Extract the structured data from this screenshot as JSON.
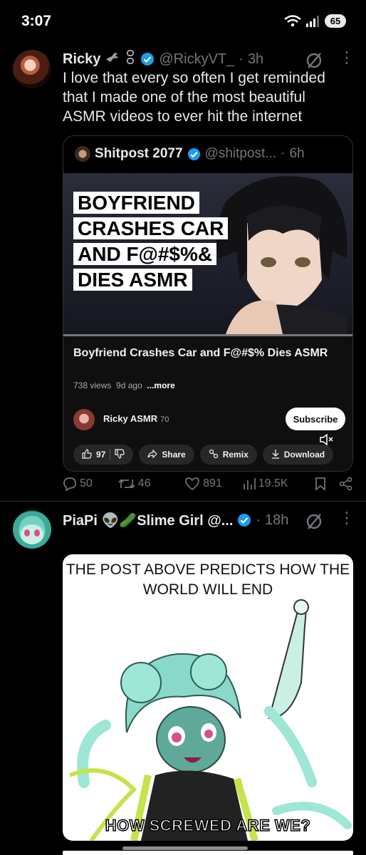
{
  "status_bar": {
    "time": "3:07",
    "battery": "65"
  },
  "post1": {
    "name": "Ricky",
    "handle": "@RickyVT_",
    "separator": "·",
    "time": "3h",
    "text": "I love that every so often I get reminded that I made one of the most beautiful ASMR videos to ever hit the internet",
    "quote": {
      "name": "Shitpost 2077",
      "handle": "@shitpost...",
      "separator": "·",
      "time": "6h",
      "thumbnail_title_lines": [
        "BOYFRIEND",
        "CRASHES CAR",
        "AND F@#$%&",
        "DIES ASMR"
      ],
      "progress": 1.0,
      "video_title": "Boyfriend Crashes Car and F@#$% Dies ASMR",
      "meta_views": "738 views",
      "meta_age": "9d ago",
      "meta_more": "...more",
      "channel": "Ricky ASMR",
      "channel_subs": "70",
      "subscribe_label": "Subscribe",
      "like_count": "97",
      "share_label": "Share",
      "remix_label": "Remix",
      "download_label": "Download"
    },
    "stats": {
      "replies": "50",
      "reposts": "46",
      "likes": "891",
      "views": "19.5K"
    }
  },
  "post2": {
    "name": "PiaPi 👽🥒Slime Girl @...",
    "separator": "·",
    "time": "18h",
    "meme_top": "THE POST ABOVE PREDICTS HOW THE WORLD WILL END",
    "meme_bottom": "HOW SCREWED ARE WE?"
  },
  "colors": {
    "accent_blue": "#1d9bf0",
    "muted": "#71767b",
    "text": "#e7e9ea"
  }
}
